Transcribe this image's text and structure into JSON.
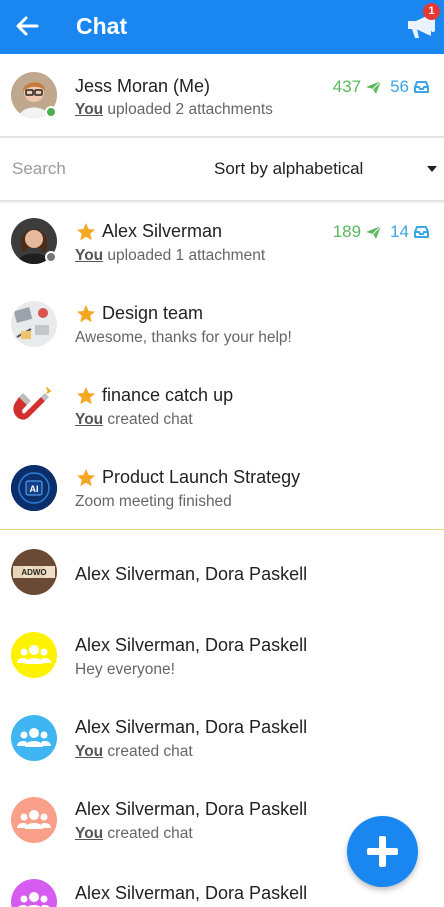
{
  "header": {
    "title": "Chat",
    "notification_count": "1",
    "bg_color": "#1a87f0"
  },
  "me": {
    "name": "Jess Moran (Me)",
    "you": "You",
    "activity": " uploaded 2 attachments",
    "sent_count": "437",
    "received_count": "56",
    "status": "online"
  },
  "search": {
    "placeholder": "Search",
    "sort_label": "Sort by alphabetical"
  },
  "favorites": [
    {
      "name": "Alex Silverman",
      "you": "You",
      "activity": " uploaded 1 attachment",
      "sent_count": "189",
      "received_count": "14",
      "status": "offline"
    },
    {
      "name": "Design team",
      "you": "",
      "activity": "Awesome, thanks for your help!"
    },
    {
      "name": "finance catch up",
      "you": "You",
      "activity": " created chat"
    },
    {
      "name": "Product Launch Strategy",
      "you": "",
      "activity": "Zoom meeting finished",
      "avatar_text": "AI"
    }
  ],
  "chats": [
    {
      "name": "Alex Silverman, Dora Paskell",
      "you": "",
      "activity": "",
      "avatar_text": "ADWO"
    },
    {
      "name": "Alex Silverman, Dora Paskell",
      "you": "",
      "activity": "Hey everyone!",
      "avatar_color": "#fff200"
    },
    {
      "name": "Alex Silverman, Dora Paskell",
      "you": "You",
      "activity": " created chat",
      "avatar_color": "#3fb6f2"
    },
    {
      "name": "Alex Silverman, Dora Paskell",
      "you": "You",
      "activity": " created chat",
      "avatar_color": "#f9a08a"
    },
    {
      "name": "Alex Silverman, Dora Paskell",
      "you": "",
      "activity": "",
      "avatar_color": "#d65bf0"
    }
  ],
  "colors": {
    "accent": "#1a87f0",
    "sent": "#5cb85c",
    "received": "#3aa6e6",
    "star": "#f5a623",
    "online": "#4caf50",
    "offline": "#777777"
  }
}
